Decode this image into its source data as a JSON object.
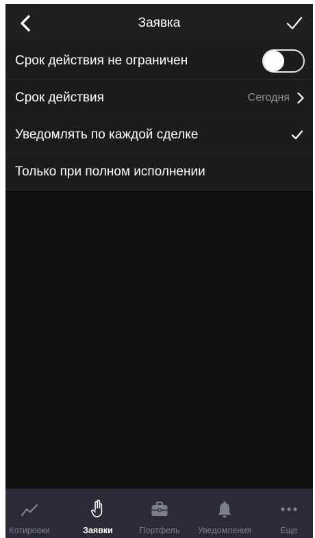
{
  "header": {
    "title": "Заявка",
    "back_icon": "chevron-left-icon",
    "done_icon": "checkmark-icon"
  },
  "rows": [
    {
      "label": "Срок действия не ограничен",
      "control": "toggle",
      "toggle_on": false
    },
    {
      "label": "Срок действия",
      "value": "Сегодня",
      "control": "chevron"
    },
    {
      "label": "Уведомлять по каждой сделке",
      "control": "checkmark",
      "checked": true
    },
    {
      "label": "Только при полном исполнении",
      "control": "none"
    }
  ],
  "tabbar": {
    "active": "Заявки",
    "tabs": [
      {
        "label": "Котировки",
        "icon": "chart-line-icon"
      },
      {
        "label": "Заявки",
        "icon": "hand-icon"
      },
      {
        "label": "Портфель",
        "icon": "briefcase-icon"
      },
      {
        "label": "Уведомления",
        "icon": "bell-icon"
      },
      {
        "label": "Еще",
        "icon": "more-dots-icon"
      }
    ]
  },
  "colors": {
    "background": "#101010",
    "navbar": "#1f1f21",
    "row": "#1c1c1e",
    "tabbar": "#2a2b36",
    "inactive_tab": "#7d7f8c",
    "secondary_text": "#8e8e93"
  }
}
